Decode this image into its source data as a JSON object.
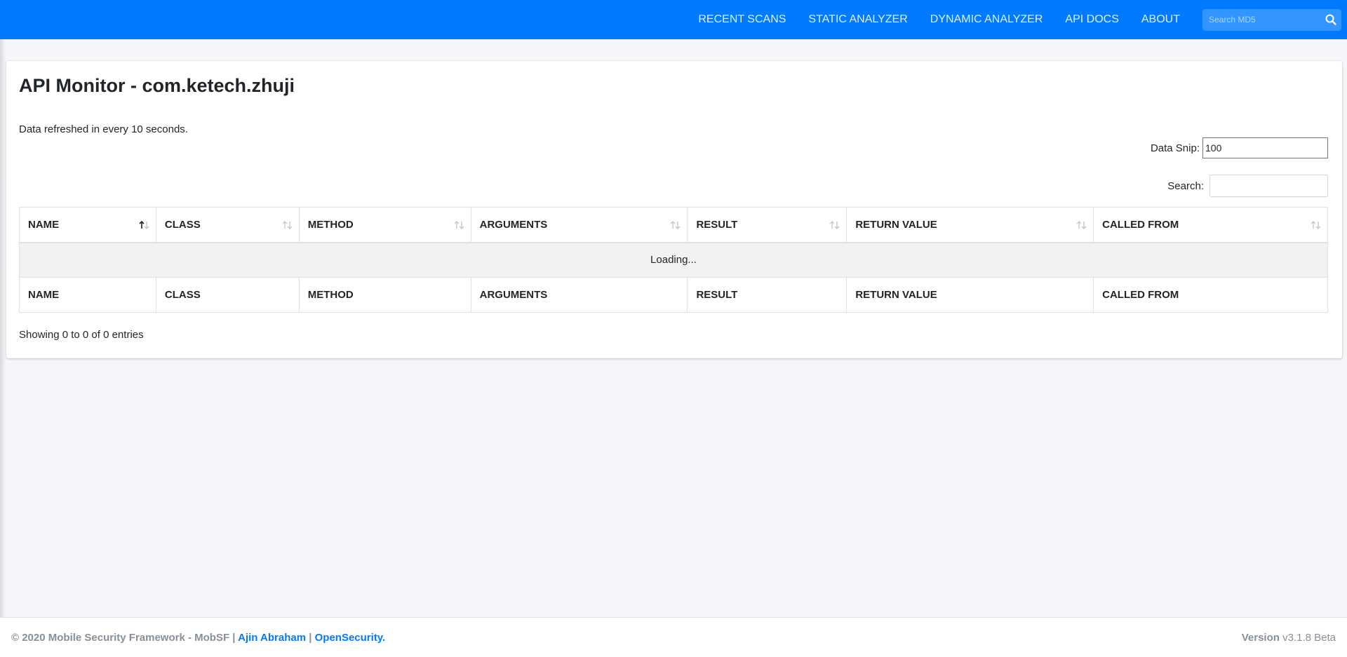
{
  "navbar": {
    "items": [
      {
        "label": "RECENT SCANS"
      },
      {
        "label": "STATIC ANALYZER"
      },
      {
        "label": "DYNAMIC ANALYZER"
      },
      {
        "label": "API DOCS"
      },
      {
        "label": "ABOUT"
      }
    ],
    "search_placeholder": "Search MD5",
    "search_icon": "search-icon"
  },
  "page": {
    "title_bold": "API Monitor",
    "title_rest": " - com.ketech.zhuji",
    "refresh_note": "Data refreshed in every 10 seconds.",
    "snip_label": "Data Snip:",
    "snip_value": "100",
    "search_label": "Search:"
  },
  "table": {
    "columns": [
      "NAME",
      "CLASS",
      "METHOD",
      "ARGUMENTS",
      "RESULT",
      "RETURN VALUE",
      "CALLED FROM"
    ],
    "loading_text": "Loading...",
    "info": "Showing 0 to 0 of 0 entries"
  },
  "footer": {
    "copyright": "© 2020 Mobile Security Framework - MobSF | ",
    "author_link": "Ajin Abraham",
    "separator": " | ",
    "org_link": "OpenSecurity.",
    "version_label": "Version",
    "version_value": " v3.1.8 Beta"
  },
  "colors": {
    "navbar": "#007bff",
    "background": "#f4f6f9",
    "link": "#007bff"
  }
}
